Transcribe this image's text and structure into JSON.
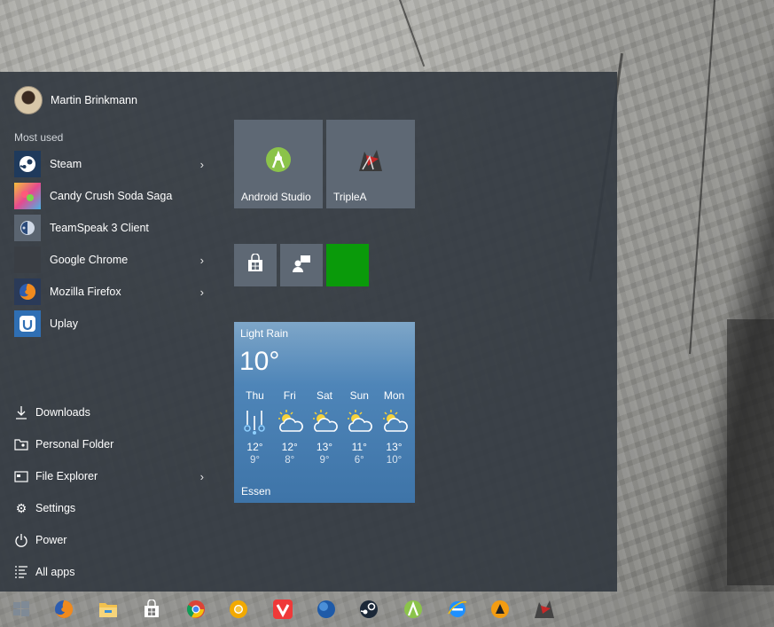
{
  "user": {
    "name": "Martin Brinkmann"
  },
  "most_used": {
    "label": "Most used",
    "items": [
      {
        "label": "Steam",
        "icon": "steam-icon",
        "has_submenu": true
      },
      {
        "label": "Candy Crush Soda Saga",
        "icon": "candy-crush-icon",
        "has_submenu": false
      },
      {
        "label": "TeamSpeak 3 Client",
        "icon": "teamspeak-icon",
        "has_submenu": false
      },
      {
        "label": "Google Chrome",
        "icon": "chrome-icon",
        "has_submenu": true
      },
      {
        "label": "Mozilla Firefox",
        "icon": "firefox-icon",
        "has_submenu": true
      },
      {
        "label": "Uplay",
        "icon": "uplay-icon",
        "has_submenu": false
      }
    ]
  },
  "system": {
    "items": [
      {
        "label": "Downloads",
        "icon": "download-icon"
      },
      {
        "label": "Personal Folder",
        "icon": "personal-folder-icon"
      },
      {
        "label": "File Explorer",
        "icon": "file-explorer-icon",
        "has_submenu": true
      },
      {
        "label": "Settings",
        "icon": "gear-icon"
      },
      {
        "label": "Power",
        "icon": "power-icon"
      },
      {
        "label": "All apps",
        "icon": "all-apps-icon"
      }
    ]
  },
  "tiles": {
    "android_studio": {
      "label": "Android Studio",
      "icon": "android-studio-icon"
    },
    "triplea": {
      "label": "TripleA",
      "icon": "triplea-icon"
    },
    "small": [
      {
        "icon": "store-icon"
      },
      {
        "icon": "feedback-icon"
      },
      {
        "icon": "green-app-icon",
        "color": "#0a9a0a"
      }
    ]
  },
  "weather": {
    "condition": "Light Rain",
    "temperature": "10°",
    "location": "Essen",
    "forecast": [
      {
        "day": "Thu",
        "icon": "rain-icon",
        "high": "12°",
        "low": "9°"
      },
      {
        "day": "Fri",
        "icon": "partly-cloudy-icon",
        "high": "12°",
        "low": "8°"
      },
      {
        "day": "Sat",
        "icon": "partly-cloudy-icon",
        "high": "13°",
        "low": "9°"
      },
      {
        "day": "Sun",
        "icon": "partly-cloudy-icon",
        "high": "11°",
        "low": "6°"
      },
      {
        "day": "Mon",
        "icon": "partly-cloudy-icon",
        "high": "13°",
        "low": "10°"
      }
    ]
  },
  "taskbar": {
    "items": [
      "start-button-icon",
      "firefox-icon",
      "file-explorer-icon",
      "store-icon",
      "chrome-icon",
      "chrome-canary-icon",
      "vivaldi-icon",
      "globe-icon",
      "steam-icon",
      "android-studio-icon",
      "ie-icon",
      "aimp-icon",
      "triplea-icon"
    ]
  },
  "colors": {
    "start_bg": "#343a42",
    "tile_bg": "#5e6874",
    "weather_bg": "#4e85b8",
    "accent_green": "#0a9a0a"
  }
}
